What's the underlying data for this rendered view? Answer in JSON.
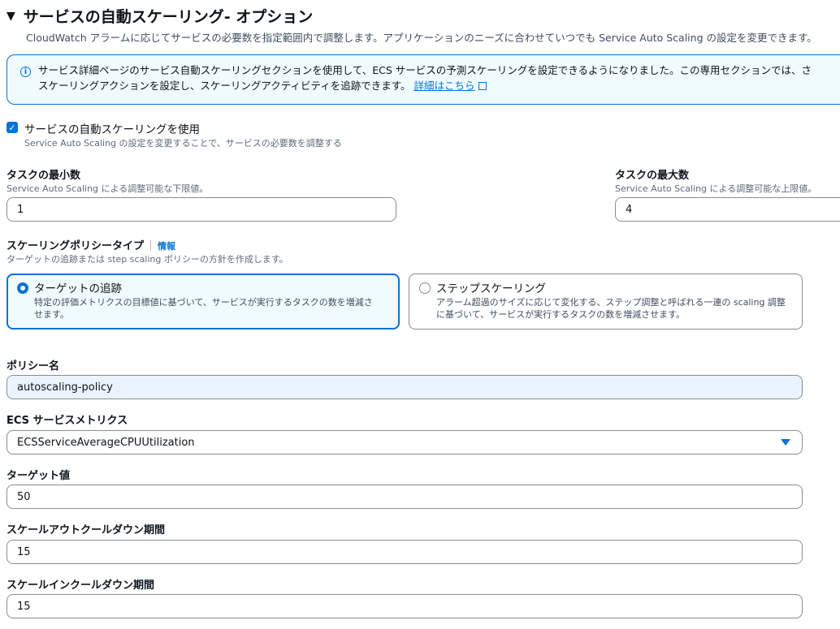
{
  "section": {
    "title": "サービスの自動スケーリング- オプション",
    "description": "CloudWatch アラームに応じてサービスの必要数を指定範囲内で調整します。アプリケーションのニーズに合わせていつでも Service Auto Scaling の設定を変更できます。"
  },
  "info_alert": {
    "line1": "サービス詳細ページのサービス自動スケーリングセクションを使用して、ECS サービスの予測スケーリングを設定できるようになりました。この専用セクションでは、さ",
    "line2": "スケーリングアクションを設定し、スケーリングアクティビティを追跡できます。",
    "link": "詳細はこちら",
    "icon": "info-icon"
  },
  "auto_scaling": {
    "checked": true,
    "label": "サービスの自動スケーリングを使用",
    "description": "Service Auto Scaling の設定を変更することで、サービスの必要数を調整する"
  },
  "min_tasks": {
    "label": "タスクの最小数",
    "hint": "Service Auto Scaling による調整可能な下限値。",
    "value": "1"
  },
  "max_tasks": {
    "label": "タスクの最大数",
    "hint": "Service Auto Scaling による調整可能な上限値。",
    "value": "4"
  },
  "policy_type": {
    "label": "スケーリングポリシータイプ",
    "info": "情報",
    "hint": "ターゲットの追跡または step scaling ポリシーの方針を作成します。",
    "options": [
      {
        "title": "ターゲットの追跡",
        "desc_line1": "特定の評価メトリクスの目標値に基づいて、サービスが実行するタスクの数を増減さ",
        "desc_line2": "せます。",
        "selected": true
      },
      {
        "title": "ステップスケーリング",
        "desc_line1": "アラーム超過のサイズに応じて変化する、ステップ調整と呼ばれる一連の scaling 調整",
        "desc_line2": "に基づいて、サービスが実行するタスクの数を増減させます。",
        "selected": false
      }
    ]
  },
  "policy_name": {
    "label": "ポリシー名",
    "value": "autoscaling-policy"
  },
  "metric": {
    "label": "ECS サービスメトリクス",
    "value": "ECSServiceAverageCPUUtilization"
  },
  "target_value": {
    "label": "ターゲット値",
    "value": "50"
  },
  "scale_out_cooldown": {
    "label": "スケールアウトクールダウン期間",
    "value": "15"
  },
  "scale_in_cooldown": {
    "label": "スケールインクールダウン期間",
    "value": "15"
  },
  "colors": {
    "accent": "#0972d3",
    "info_bg": "#f0fbff",
    "text": "#0f141a"
  }
}
